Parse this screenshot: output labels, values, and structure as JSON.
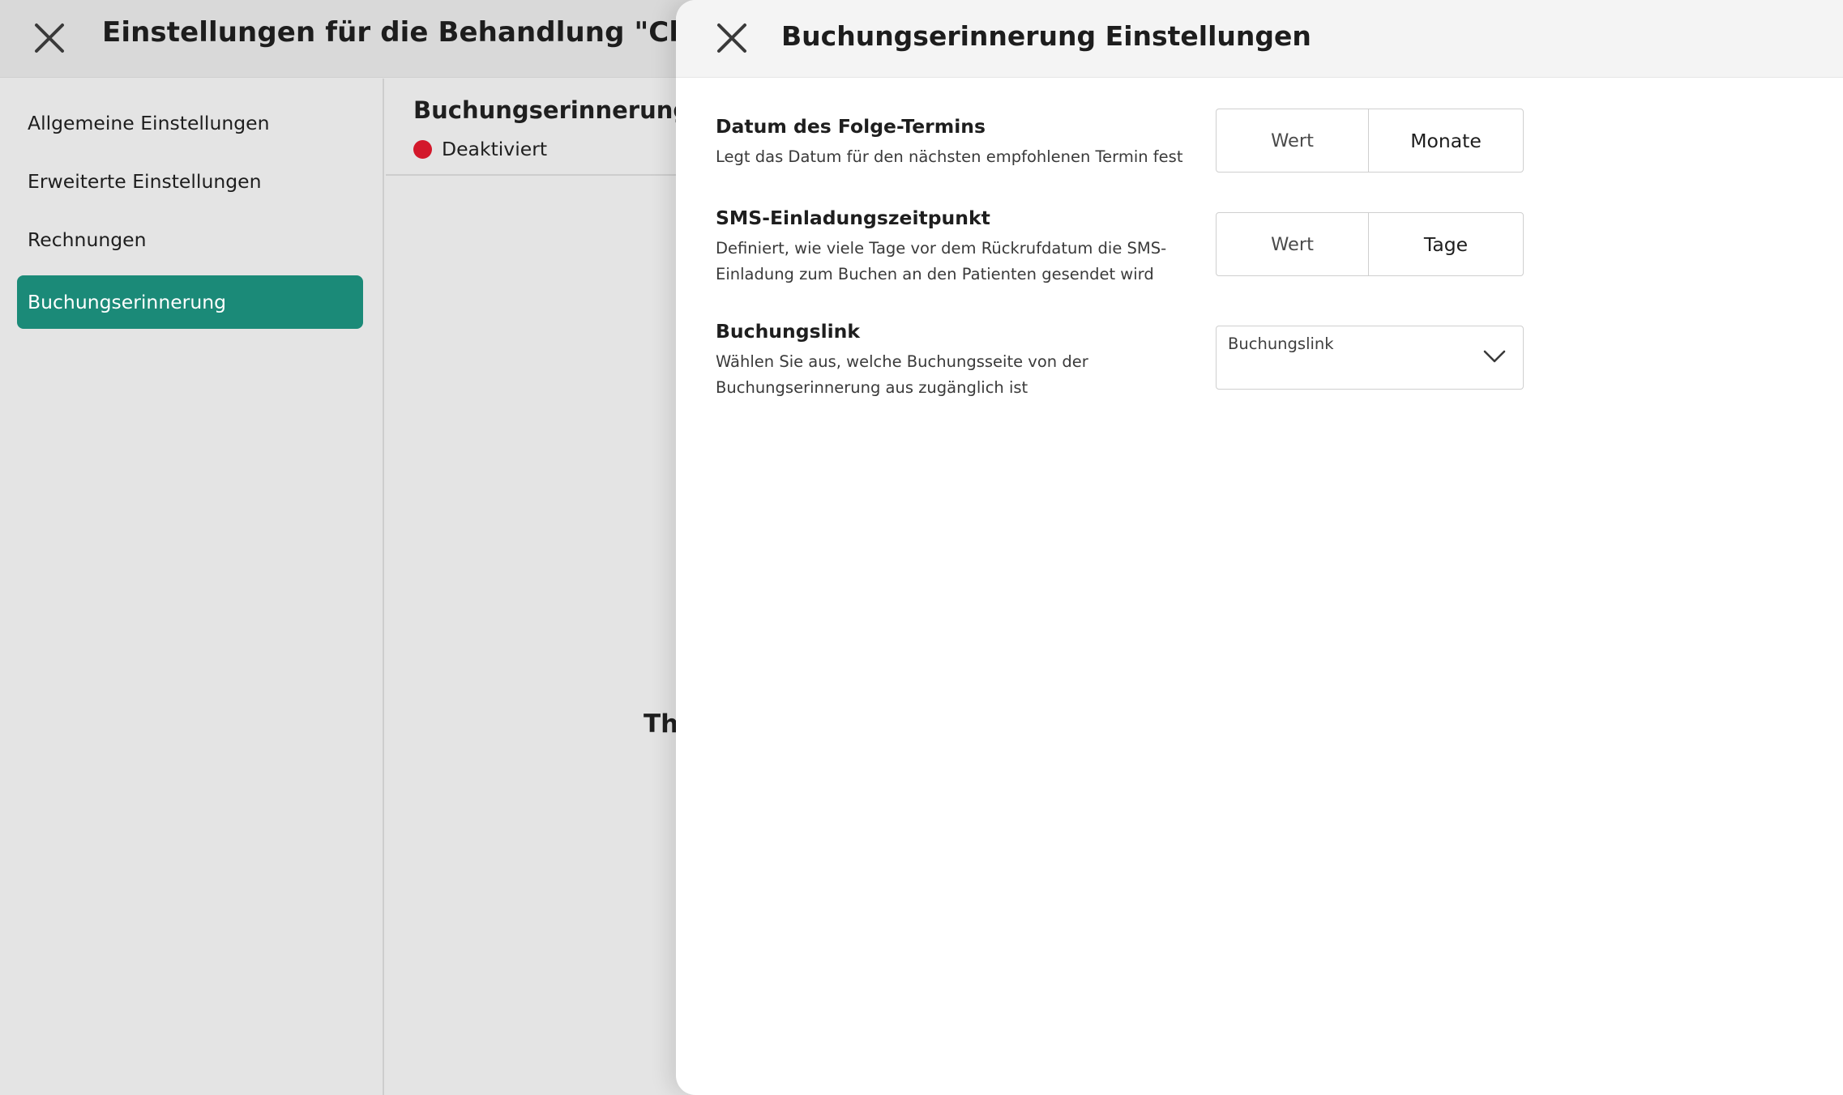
{
  "background": {
    "title": "Einstellungen für die Behandlung \"Check-up\"",
    "sidebar": {
      "items": [
        {
          "label": "Allgemeine Einstellungen"
        },
        {
          "label": "Erweiterte Einstellungen"
        },
        {
          "label": "Rechnungen"
        },
        {
          "label": "Buchungserinnerung"
        }
      ]
    },
    "content": {
      "title": "Buchungserinnerung",
      "status": "Deaktiviert",
      "status_color": "#d3182b",
      "center_text": "Th"
    },
    "accent_color": "#1b8a78"
  },
  "drawer": {
    "title": "Buchungserinnerung Einstellungen",
    "settings": [
      {
        "label": "Datum des Folge-Termins",
        "description": "Legt das Datum für den nächsten empfohlenen Termin fest",
        "value_placeholder": "Wert",
        "unit": "Monate"
      },
      {
        "label": "SMS-Einladungszeitpunkt",
        "description": "Definiert, wie viele Tage vor dem Rückrufdatum die SMS-Einladung zum Buchen an den Patienten gesendet wird",
        "value_placeholder": "Wert",
        "unit": "Tage"
      },
      {
        "label": "Buchungslink",
        "description": "Wählen Sie aus, welche Buchungsseite von der Buchungserinnerung aus zugänglich ist",
        "select_label": "Buchungslink"
      }
    ]
  },
  "icons": {
    "close": "close-icon",
    "chevron": "chevron-down-icon"
  }
}
